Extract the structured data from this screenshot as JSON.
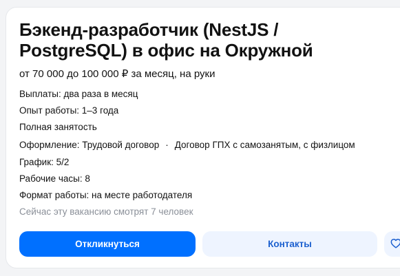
{
  "vacancy": {
    "title": "Бэкенд-разработчик (NestJS / PostgreSQL) в офис на Окружной",
    "salary": "от 70 000 до 100 000 ₽ за месяц, на руки",
    "payments": "Выплаты: два раза в месяц",
    "experience": "Опыт работы: 1–3 года",
    "employment": "Полная занятость",
    "contract_label": "Оформление: Трудовой договор",
    "contract_dot": "·",
    "contract_alt": "Договор ГПХ с самозанятым, с физлицом",
    "schedule": "График: 5/2",
    "hours": "Рабочие часы: 8",
    "work_format": "Формат работы: на месте работодателя",
    "viewers": "Сейчас эту вакансию смотрят 7 человек"
  },
  "actions": {
    "apply_label": "Откликнуться",
    "contacts_label": "Контакты",
    "favorite_icon": "heart-icon"
  },
  "colors": {
    "primary": "#0070ff",
    "secondary_bg": "#eef4ff",
    "secondary_text": "#1b5fcf",
    "hint": "#8a8f98"
  }
}
